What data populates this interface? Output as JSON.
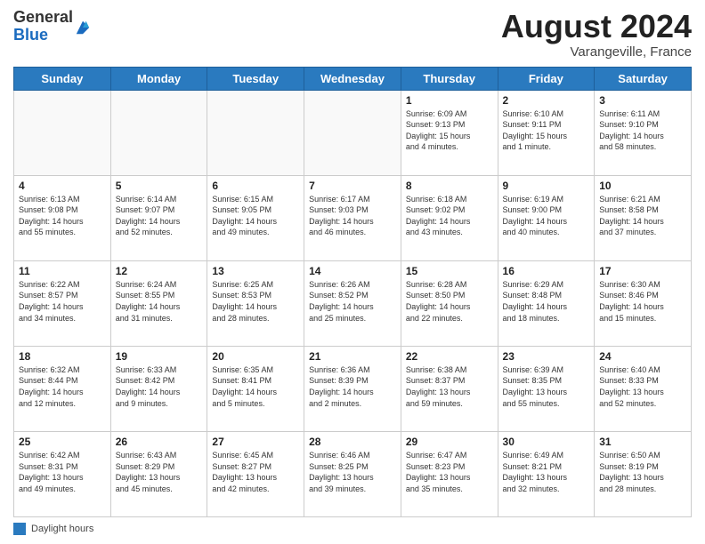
{
  "header": {
    "logo_general": "General",
    "logo_blue": "Blue",
    "month_title": "August 2024",
    "location": "Varangeville, France"
  },
  "footer": {
    "daylight_label": "Daylight hours"
  },
  "weekdays": [
    "Sunday",
    "Monday",
    "Tuesday",
    "Wednesday",
    "Thursday",
    "Friday",
    "Saturday"
  ],
  "weeks": [
    [
      {
        "day": "",
        "info": ""
      },
      {
        "day": "",
        "info": ""
      },
      {
        "day": "",
        "info": ""
      },
      {
        "day": "",
        "info": ""
      },
      {
        "day": "1",
        "info": "Sunrise: 6:09 AM\nSunset: 9:13 PM\nDaylight: 15 hours\nand 4 minutes."
      },
      {
        "day": "2",
        "info": "Sunrise: 6:10 AM\nSunset: 9:11 PM\nDaylight: 15 hours\nand 1 minute."
      },
      {
        "day": "3",
        "info": "Sunrise: 6:11 AM\nSunset: 9:10 PM\nDaylight: 14 hours\nand 58 minutes."
      }
    ],
    [
      {
        "day": "4",
        "info": "Sunrise: 6:13 AM\nSunset: 9:08 PM\nDaylight: 14 hours\nand 55 minutes."
      },
      {
        "day": "5",
        "info": "Sunrise: 6:14 AM\nSunset: 9:07 PM\nDaylight: 14 hours\nand 52 minutes."
      },
      {
        "day": "6",
        "info": "Sunrise: 6:15 AM\nSunset: 9:05 PM\nDaylight: 14 hours\nand 49 minutes."
      },
      {
        "day": "7",
        "info": "Sunrise: 6:17 AM\nSunset: 9:03 PM\nDaylight: 14 hours\nand 46 minutes."
      },
      {
        "day": "8",
        "info": "Sunrise: 6:18 AM\nSunset: 9:02 PM\nDaylight: 14 hours\nand 43 minutes."
      },
      {
        "day": "9",
        "info": "Sunrise: 6:19 AM\nSunset: 9:00 PM\nDaylight: 14 hours\nand 40 minutes."
      },
      {
        "day": "10",
        "info": "Sunrise: 6:21 AM\nSunset: 8:58 PM\nDaylight: 14 hours\nand 37 minutes."
      }
    ],
    [
      {
        "day": "11",
        "info": "Sunrise: 6:22 AM\nSunset: 8:57 PM\nDaylight: 14 hours\nand 34 minutes."
      },
      {
        "day": "12",
        "info": "Sunrise: 6:24 AM\nSunset: 8:55 PM\nDaylight: 14 hours\nand 31 minutes."
      },
      {
        "day": "13",
        "info": "Sunrise: 6:25 AM\nSunset: 8:53 PM\nDaylight: 14 hours\nand 28 minutes."
      },
      {
        "day": "14",
        "info": "Sunrise: 6:26 AM\nSunset: 8:52 PM\nDaylight: 14 hours\nand 25 minutes."
      },
      {
        "day": "15",
        "info": "Sunrise: 6:28 AM\nSunset: 8:50 PM\nDaylight: 14 hours\nand 22 minutes."
      },
      {
        "day": "16",
        "info": "Sunrise: 6:29 AM\nSunset: 8:48 PM\nDaylight: 14 hours\nand 18 minutes."
      },
      {
        "day": "17",
        "info": "Sunrise: 6:30 AM\nSunset: 8:46 PM\nDaylight: 14 hours\nand 15 minutes."
      }
    ],
    [
      {
        "day": "18",
        "info": "Sunrise: 6:32 AM\nSunset: 8:44 PM\nDaylight: 14 hours\nand 12 minutes."
      },
      {
        "day": "19",
        "info": "Sunrise: 6:33 AM\nSunset: 8:42 PM\nDaylight: 14 hours\nand 9 minutes."
      },
      {
        "day": "20",
        "info": "Sunrise: 6:35 AM\nSunset: 8:41 PM\nDaylight: 14 hours\nand 5 minutes."
      },
      {
        "day": "21",
        "info": "Sunrise: 6:36 AM\nSunset: 8:39 PM\nDaylight: 14 hours\nand 2 minutes."
      },
      {
        "day": "22",
        "info": "Sunrise: 6:38 AM\nSunset: 8:37 PM\nDaylight: 13 hours\nand 59 minutes."
      },
      {
        "day": "23",
        "info": "Sunrise: 6:39 AM\nSunset: 8:35 PM\nDaylight: 13 hours\nand 55 minutes."
      },
      {
        "day": "24",
        "info": "Sunrise: 6:40 AM\nSunset: 8:33 PM\nDaylight: 13 hours\nand 52 minutes."
      }
    ],
    [
      {
        "day": "25",
        "info": "Sunrise: 6:42 AM\nSunset: 8:31 PM\nDaylight: 13 hours\nand 49 minutes."
      },
      {
        "day": "26",
        "info": "Sunrise: 6:43 AM\nSunset: 8:29 PM\nDaylight: 13 hours\nand 45 minutes."
      },
      {
        "day": "27",
        "info": "Sunrise: 6:45 AM\nSunset: 8:27 PM\nDaylight: 13 hours\nand 42 minutes."
      },
      {
        "day": "28",
        "info": "Sunrise: 6:46 AM\nSunset: 8:25 PM\nDaylight: 13 hours\nand 39 minutes."
      },
      {
        "day": "29",
        "info": "Sunrise: 6:47 AM\nSunset: 8:23 PM\nDaylight: 13 hours\nand 35 minutes."
      },
      {
        "day": "30",
        "info": "Sunrise: 6:49 AM\nSunset: 8:21 PM\nDaylight: 13 hours\nand 32 minutes."
      },
      {
        "day": "31",
        "info": "Sunrise: 6:50 AM\nSunset: 8:19 PM\nDaylight: 13 hours\nand 28 minutes."
      }
    ]
  ]
}
